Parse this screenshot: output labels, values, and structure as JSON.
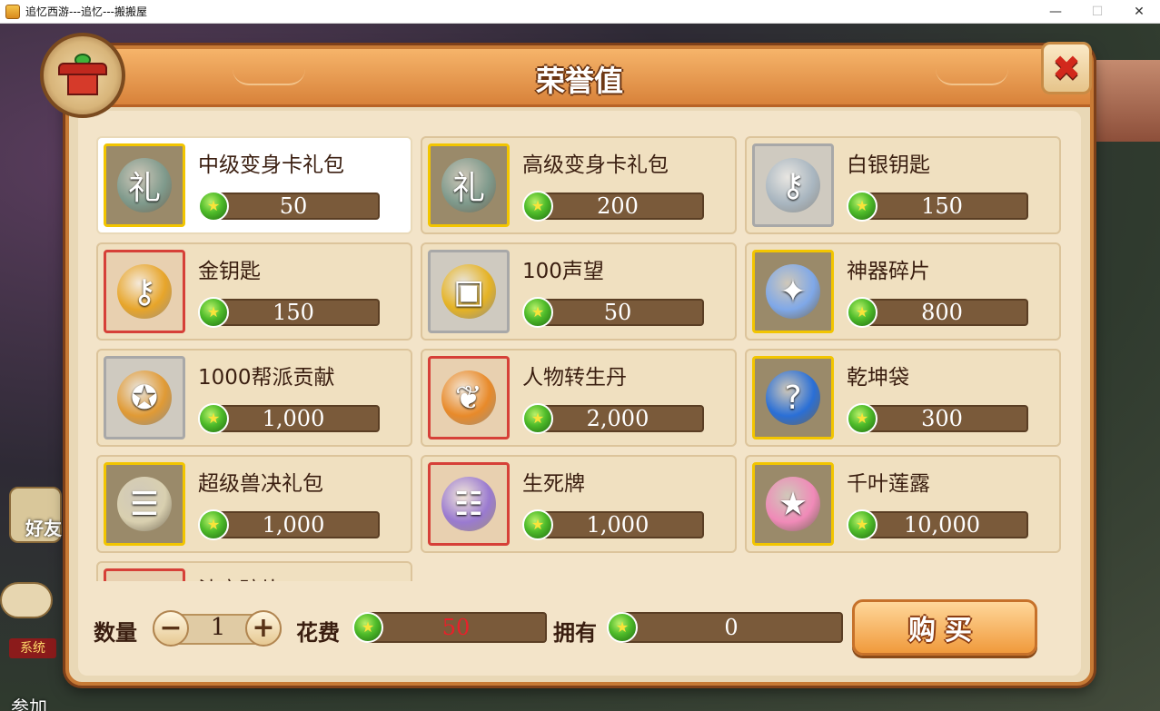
{
  "window": {
    "title": "追忆西游---追忆---搬搬屋",
    "minimize_glyph": "—",
    "maximize_glyph": "☐",
    "close_glyph": "✕"
  },
  "background": {
    "friend_label": "好友",
    "system_tag": "系统",
    "join_text": "参加"
  },
  "panel": {
    "title": "荣誉值",
    "close_glyph": "✖"
  },
  "items": [
    {
      "name": "中级变身卡礼包",
      "price": "50",
      "frame": "gold",
      "icon": "gift-bag-icon",
      "icon_color": "#7f9a8c",
      "glyph": "礼"
    },
    {
      "name": "高级变身卡礼包",
      "price": "200",
      "frame": "gold",
      "icon": "gift-bag-icon",
      "icon_color": "#7f9a8c",
      "glyph": "礼"
    },
    {
      "name": "白银钥匙",
      "price": "150",
      "frame": "silver",
      "icon": "silver-key-icon",
      "icon_color": "#a9b6c0",
      "glyph": "⚷"
    },
    {
      "name": "金钥匙",
      "price": "150",
      "frame": "red",
      "icon": "gold-key-icon",
      "icon_color": "#e7a52a",
      "glyph": "⚷"
    },
    {
      "name": "100声望",
      "price": "50",
      "frame": "silver",
      "icon": "gold-coin-icon",
      "icon_color": "#e5b325",
      "glyph": "▣"
    },
    {
      "name": "神器碎片",
      "price": "800",
      "frame": "gold",
      "icon": "crystal-shard-icon",
      "icon_color": "#7fa8e8",
      "glyph": "✦"
    },
    {
      "name": "1000帮派贡献",
      "price": "1,000",
      "frame": "silver",
      "icon": "guild-medal-icon",
      "icon_color": "#e09a35",
      "glyph": "✪"
    },
    {
      "name": "人物转生丹",
      "price": "2,000",
      "frame": "red",
      "icon": "gourd-icon",
      "icon_color": "#e88a2a",
      "glyph": "❦"
    },
    {
      "name": "乾坤袋",
      "price": "300",
      "frame": "gold",
      "icon": "mystery-orb-icon",
      "icon_color": "#2a6fd6",
      "glyph": "?"
    },
    {
      "name": "超级兽决礼包",
      "price": "1,000",
      "frame": "gold",
      "icon": "scroll-book-icon",
      "icon_color": "#d9d0b0",
      "glyph": "☰"
    },
    {
      "name": "生死牌",
      "price": "1,000",
      "frame": "red",
      "icon": "purple-scroll-icon",
      "icon_color": "#9a7ad0",
      "glyph": "☷"
    },
    {
      "name": "千叶莲露",
      "price": "10,000",
      "frame": "gold",
      "icon": "lotus-orb-icon",
      "icon_color": "#f08ab8",
      "glyph": "★"
    },
    {
      "name": "法宝碎片",
      "price": "",
      "frame": "red",
      "icon": "treasure-shard-icon",
      "icon_color": "#7fc0d0",
      "glyph": ""
    }
  ],
  "purchase": {
    "quantity_label": "数量",
    "quantity": "1",
    "minus_glyph": "−",
    "plus_glyph": "+",
    "cost_label": "花费",
    "cost": "50",
    "owned_label": "拥有",
    "owned": "0",
    "buy_label": "购买"
  },
  "colors": {
    "cost_text": "#e8202a",
    "owned_text": "#ffffff",
    "selected_item_bg": "#ffffff"
  }
}
